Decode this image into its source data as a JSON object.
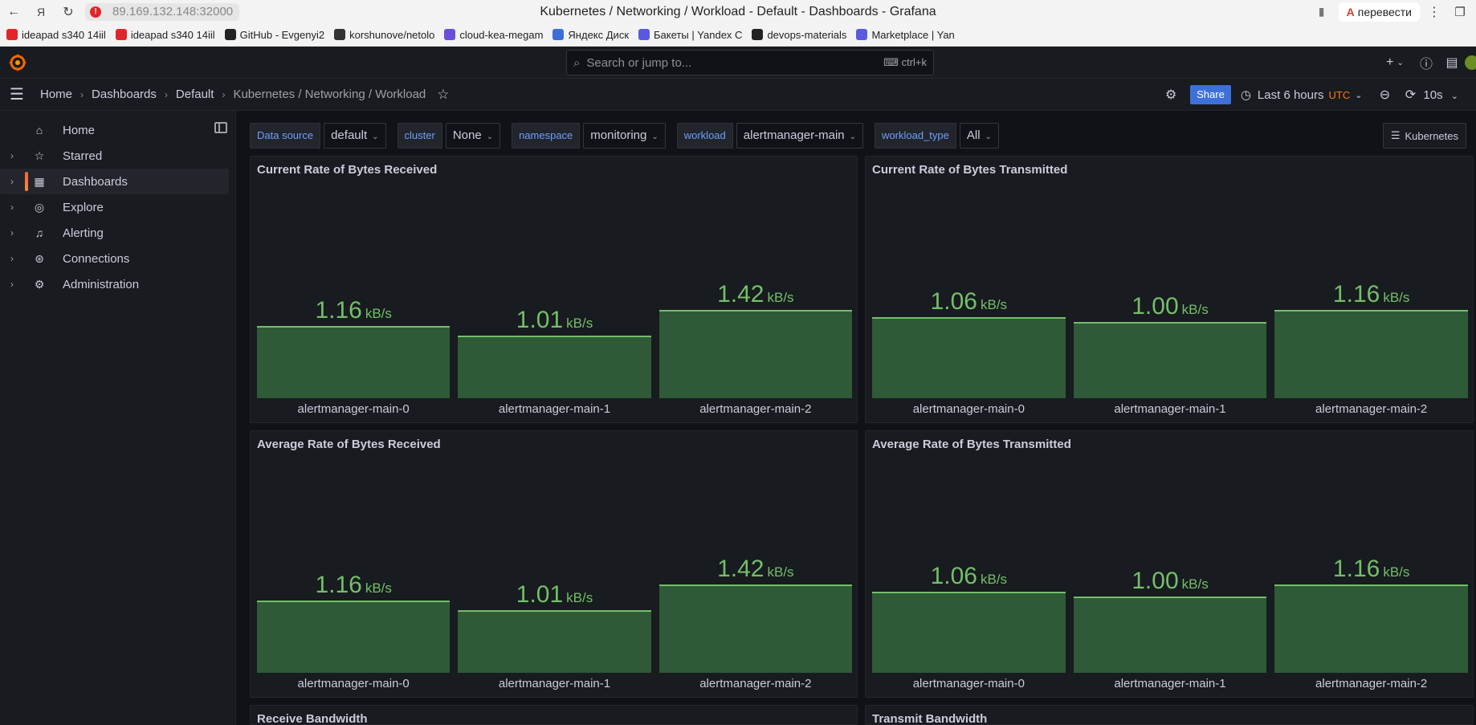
{
  "browser": {
    "url": "89.169.132.148:32000",
    "tab_title": "Kubernetes / Networking / Workload - Default - Dashboards - Grafana",
    "translate_label": "перевести",
    "bookmarks": [
      {
        "label": "ideapad s340 14iil",
        "color": "#e0262a"
      },
      {
        "label": "ideapad s340 14iil",
        "color": "#e0262a"
      },
      {
        "label": "GitHub - Evgenyi2",
        "color": "#222222"
      },
      {
        "label": "korshunove/netolo",
        "color": "#333333"
      },
      {
        "label": "cloud-kea-megam",
        "color": "#6b4fd8"
      },
      {
        "label": "Яндекс Диск",
        "color": "#3a6fd8"
      },
      {
        "label": "Бакеты | Yandex C",
        "color": "#5a5ae0"
      },
      {
        "label": "devops-materials",
        "color": "#222222"
      },
      {
        "label": "Marketplace | Yan",
        "color": "#5a5ae0"
      }
    ]
  },
  "grafana": {
    "search_placeholder": "Search or jump to...",
    "search_shortcut": "ctrl+k",
    "breadcrumbs": [
      "Home",
      "Dashboards",
      "Default",
      "Kubernetes / Networking / Workload"
    ],
    "share_label": "Share",
    "time_range": "Last 6 hours",
    "timezone": "UTC",
    "refresh_interval": "10s",
    "links_label": "Kubernetes",
    "nav": [
      {
        "label": "Home",
        "icon": "home-icon",
        "glyph": "⌂",
        "expandable": false,
        "active": false
      },
      {
        "label": "Starred",
        "icon": "star-icon",
        "glyph": "☆",
        "expandable": true,
        "active": false
      },
      {
        "label": "Dashboards",
        "icon": "apps-icon",
        "glyph": "▦",
        "expandable": true,
        "active": true
      },
      {
        "label": "Explore",
        "icon": "compass-icon",
        "glyph": "◎",
        "expandable": true,
        "active": false
      },
      {
        "label": "Alerting",
        "icon": "bell-icon",
        "glyph": "♫",
        "expandable": true,
        "active": false
      },
      {
        "label": "Connections",
        "icon": "connections-icon",
        "glyph": "⊛",
        "expandable": true,
        "active": false
      },
      {
        "label": "Administration",
        "icon": "cog-icon",
        "glyph": "⚙",
        "expandable": true,
        "active": false
      }
    ],
    "variables": [
      {
        "label": "Data source",
        "value": "default"
      },
      {
        "label": "cluster",
        "value": "None"
      },
      {
        "label": "namespace",
        "value": "monitoring"
      },
      {
        "label": "workload",
        "value": "alertmanager-main"
      },
      {
        "label": "workload_type",
        "value": "All"
      }
    ],
    "panels": [
      {
        "title": "Current Rate of Bytes Received",
        "unit": "kB/s",
        "max": 1.42,
        "bars": [
          {
            "label": "alertmanager-main-0",
            "value": "1.16"
          },
          {
            "label": "alertmanager-main-1",
            "value": "1.01"
          },
          {
            "label": "alertmanager-main-2",
            "value": "1.42"
          }
        ]
      },
      {
        "title": "Current Rate of Bytes Transmitted",
        "unit": "kB/s",
        "max": 1.16,
        "bars": [
          {
            "label": "alertmanager-main-0",
            "value": "1.06"
          },
          {
            "label": "alertmanager-main-1",
            "value": "1.00"
          },
          {
            "label": "alertmanager-main-2",
            "value": "1.16"
          }
        ]
      },
      {
        "title": "Average Rate of Bytes Received",
        "unit": "kB/s",
        "max": 1.42,
        "bars": [
          {
            "label": "alertmanager-main-0",
            "value": "1.16"
          },
          {
            "label": "alertmanager-main-1",
            "value": "1.01"
          },
          {
            "label": "alertmanager-main-2",
            "value": "1.42"
          }
        ]
      },
      {
        "title": "Average Rate of Bytes Transmitted",
        "unit": "kB/s",
        "max": 1.16,
        "bars": [
          {
            "label": "alertmanager-main-0",
            "value": "1.06"
          },
          {
            "label": "alertmanager-main-1",
            "value": "1.00"
          },
          {
            "label": "alertmanager-main-2",
            "value": "1.16"
          }
        ]
      },
      {
        "title": "Receive Bandwidth",
        "unit": "",
        "bars": []
      },
      {
        "title": "Transmit Bandwidth",
        "unit": "",
        "bars": []
      }
    ],
    "colors": {
      "accent_green": "#73bf69",
      "bar_fill": "#2f5a37",
      "share_blue": "#3d71d9",
      "utc_orange": "#ff780a",
      "variable_label": "#6e9fff"
    }
  }
}
